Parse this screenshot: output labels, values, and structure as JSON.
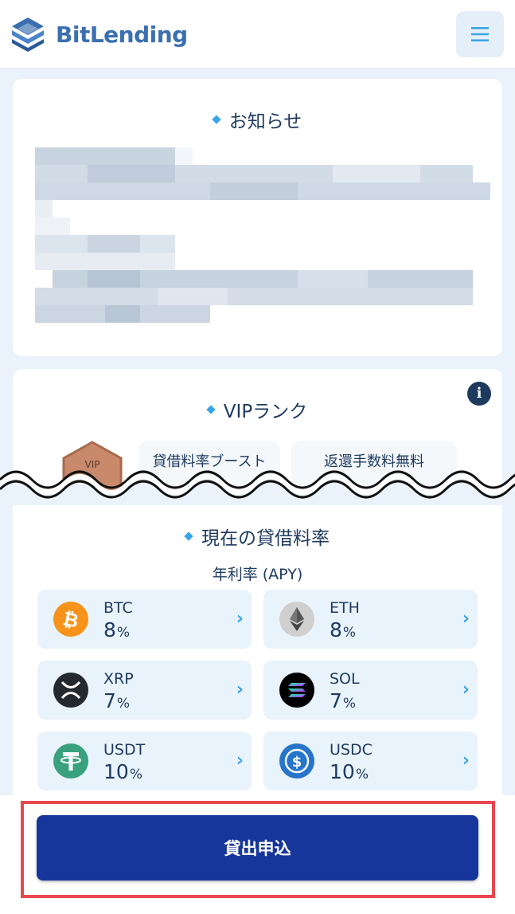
{
  "header": {
    "logo_text": "BitLending",
    "menu_icon": "hamburger-icon"
  },
  "notice": {
    "title": "お知らせ"
  },
  "vip": {
    "title": "VIPランク",
    "badge_text": "VIP",
    "tag_boost": "貸借料率ブースト",
    "tag_fee": "返還手数料無料",
    "info_icon_label": "i"
  },
  "rates": {
    "title": "現在の貸借料率",
    "apy_label": "年利率 (APY)",
    "coins": [
      {
        "name": "BTC",
        "rate": "8",
        "unit": "%",
        "icon": "bitcoin-icon",
        "color": "#f7931a"
      },
      {
        "name": "ETH",
        "rate": "8",
        "unit": "%",
        "icon": "ethereum-icon",
        "color": "#c9c9c9"
      },
      {
        "name": "XRP",
        "rate": "7",
        "unit": "%",
        "icon": "xrp-icon",
        "color": "#23292f"
      },
      {
        "name": "SOL",
        "rate": "7",
        "unit": "%",
        "icon": "solana-icon",
        "color": "#000000"
      },
      {
        "name": "USDT",
        "rate": "10",
        "unit": "%",
        "icon": "tether-icon",
        "color": "#3aa17e"
      },
      {
        "name": "USDC",
        "rate": "10",
        "unit": "%",
        "icon": "usdc-icon",
        "color": "#2775ca"
      }
    ]
  },
  "cta": {
    "label": "貸出申込"
  },
  "colors": {
    "accent": "#38a3e8",
    "primary_button": "#16369b",
    "highlight": "#e8474f",
    "background": "#eaf3fc"
  }
}
